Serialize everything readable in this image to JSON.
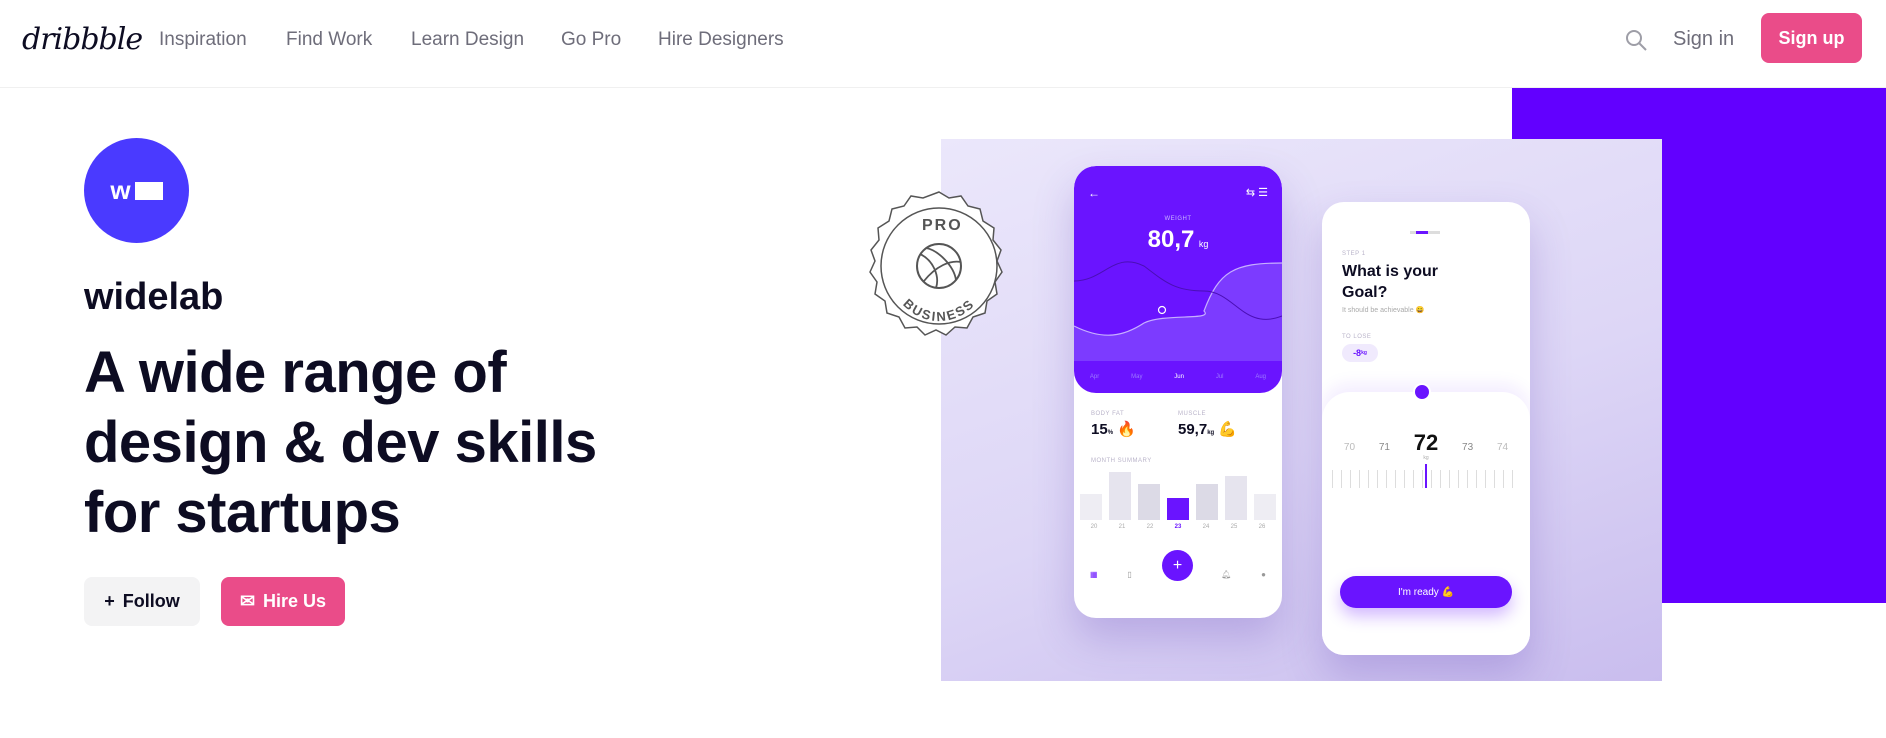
{
  "nav": {
    "logo": "dribbble",
    "items": [
      "Inspiration",
      "Find Work",
      "Learn Design",
      "Go Pro",
      "Hire Designers"
    ],
    "search_icon": "search-icon",
    "sign_in": "Sign in",
    "sign_up": "Sign up"
  },
  "profile": {
    "avatar_text": "w",
    "name": "widelab",
    "headline": "A wide range of design & dev skills for startups",
    "follow": "Follow",
    "hire": "Hire Us"
  },
  "colors": {
    "brand_pink": "#ea4c89",
    "accent_purple": "#6200ff"
  },
  "shot": {
    "badge_top": "PRO",
    "badge_bottom": "BUSINESS",
    "phone1": {
      "label": "WEIGHT",
      "value": "80,7",
      "unit": "kg",
      "months": [
        "Apr",
        "May",
        "Jun",
        "Jul",
        "Aug"
      ],
      "body_fat_label": "BODY FAT",
      "body_fat": "15",
      "body_fat_unit": "%",
      "muscle_label": "MUSCLE",
      "muscle": "59,7",
      "muscle_unit": "kg",
      "summary_label": "MONTH SUMMARY",
      "days": [
        "20",
        "21",
        "22",
        "23",
        "24",
        "25",
        "26"
      ]
    },
    "phone2": {
      "step": "STEP 1",
      "title": "What is your Goal?",
      "subtitle": "It should be achievable 😄",
      "to_lose_label": "TO LOSE",
      "to_lose": "-8",
      "to_lose_unit": "kg",
      "scale": [
        "70",
        "71",
        "72",
        "73",
        "74"
      ],
      "scale_unit": "kg",
      "button": "I'm ready 💪"
    }
  }
}
